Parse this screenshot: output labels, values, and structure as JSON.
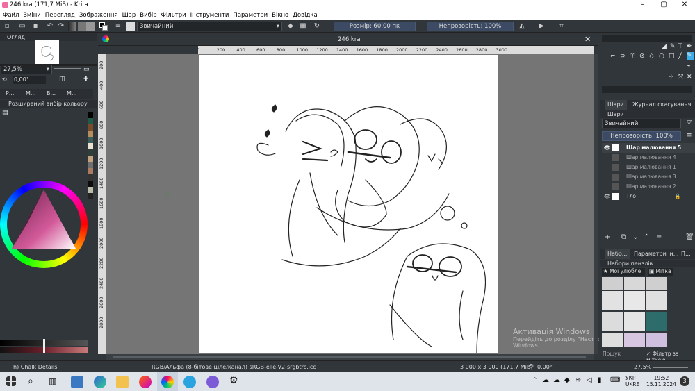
{
  "window": {
    "title": "246.kra (171,7 МіБ) - Krita"
  },
  "menu": [
    "Файл",
    "Зміни",
    "Перегляд",
    "Зображення",
    "Шар",
    "Вибір",
    "Фільтри",
    "Інструменти",
    "Параметри",
    "Вікно",
    "Довідка"
  ],
  "toolbar": {
    "blend_mode": "Звичайний",
    "size_label": "Розмір: 60,00 пк",
    "opacity_label": "Непрозорість: 100%"
  },
  "left": {
    "overview_title": "Огляд",
    "zoom_value": "27,5%",
    "rotation_value": "0,00°",
    "short_tabs": [
      "Р...",
      "М...",
      "В...",
      "М..."
    ],
    "color_selector_title": "Розширений вибір кольору"
  },
  "document": {
    "tab_title": "246.kra"
  },
  "ruler": {
    "top_ticks": [
      "0",
      "200",
      "400",
      "600",
      "800",
      "1000",
      "1200",
      "1400",
      "1600",
      "1800",
      "2000",
      "2200",
      "2400",
      "2600",
      "2800",
      "3000"
    ],
    "left_ticks": [
      "200",
      "400",
      "600",
      "800",
      "1000",
      "1200",
      "1400",
      "1600",
      "1800",
      "2000",
      "2200",
      "2400",
      "2600",
      "2800"
    ]
  },
  "layers_panel": {
    "tabs": [
      "Шари",
      "Журнал скасування"
    ],
    "title": "Шари",
    "blend_mode": "Звичайний",
    "opacity_label": "Непрозорість: 100%",
    "layers": [
      {
        "name": "Шар малювання 5",
        "active": true
      },
      {
        "name": "Шар малювання 4",
        "active": false
      },
      {
        "name": "Шар малювання 1",
        "active": false
      },
      {
        "name": "Шар малювання 3",
        "active": false
      },
      {
        "name": "Шар малювання 2",
        "active": false
      },
      {
        "name": "Тло",
        "active": false
      }
    ]
  },
  "brush_panel": {
    "tabs": [
      "Набо...",
      "Параметри ін...",
      "П..."
    ],
    "title": "Набори пензлів",
    "favorites": "Мої улюбле",
    "tag": "Мітка",
    "search_placeholder": "Пошук",
    "filter_label": "Фільтр за міткою"
  },
  "watermark": {
    "line1": "Активація Windows",
    "line2": "Перейдіть до розділу \"Настройки\", щоб активувати",
    "line3": "Windows."
  },
  "status": {
    "brush": "h) Chalk Details",
    "color_model": "RGB/Альфа (8-бітове ціле/канал)  sRGB-elle-V2-srgbtrc.icc",
    "dimensions": "3 000 x 3 000 (171,7 МіБ)",
    "rotation": "0,00°",
    "zoom": "27,5%"
  },
  "taskbar": {
    "lang1": "УКР",
    "lang2": "UKRE",
    "time": "19:52",
    "date": "15.11.2024",
    "notifications": "3"
  },
  "colors": {
    "accent": "#3daee9",
    "dock_bg": "#31363b",
    "canvas_bg": "#757575"
  }
}
